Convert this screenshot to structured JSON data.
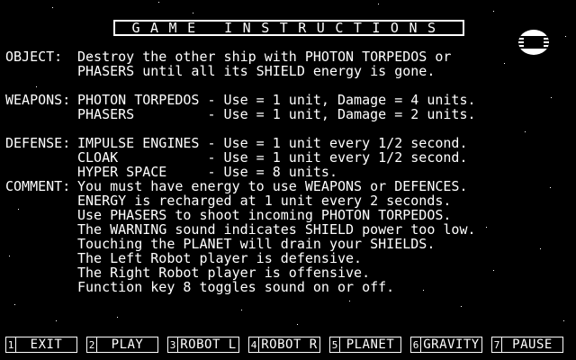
{
  "title": "GAME INSTRUCTIONS",
  "planet_icon": "planet-icon",
  "colors": {
    "background": "#000000",
    "foreground": "#ffffff"
  },
  "sections": {
    "object": {
      "label": "OBJECT:",
      "lines": [
        "Destroy the other ship with PHOTON TORPEDOS or",
        "PHASERS until all its SHIELD energy is gone."
      ]
    },
    "weapons": {
      "label": "WEAPONS:",
      "lines": [
        "PHOTON TORPEDOS - Use = 1 unit, Damage = 4 units.",
        "PHASERS         - Use = 1 unit, Damage = 2 units."
      ]
    },
    "defense": {
      "label": "DEFENSE:",
      "lines": [
        "IMPULSE ENGINES - Use = 1 unit every 1/2 second.",
        "CLOAK           - Use = 1 unit every 1/2 second.",
        "HYPER SPACE     - Use = 8 units."
      ]
    },
    "comment": {
      "label": "COMMENT:",
      "lines": [
        "You must have energy to use WEAPONS or DEFENCES.",
        "ENERGY is recharged at 1 unit every 2 seconds.",
        "Use PHASERS to shoot incoming PHOTON TORPEDOS.",
        "The WARNING sound indicates SHIELD power too low.",
        "Touching the PLANET will drain your SHIELDS.",
        "The Left Robot player is defensive.",
        "The Right Robot player is offensive.",
        "Function key 8 toggles sound on or off."
      ]
    }
  },
  "function_keys": [
    {
      "num": "1",
      "label": "EXIT"
    },
    {
      "num": "2",
      "label": "PLAY"
    },
    {
      "num": "3",
      "label": "ROBOT L"
    },
    {
      "num": "4",
      "label": "ROBOT R"
    },
    {
      "num": "5",
      "label": "PLANET"
    },
    {
      "num": "6",
      "label": "GRAVITY"
    },
    {
      "num": "7",
      "label": "PAUSE"
    }
  ]
}
